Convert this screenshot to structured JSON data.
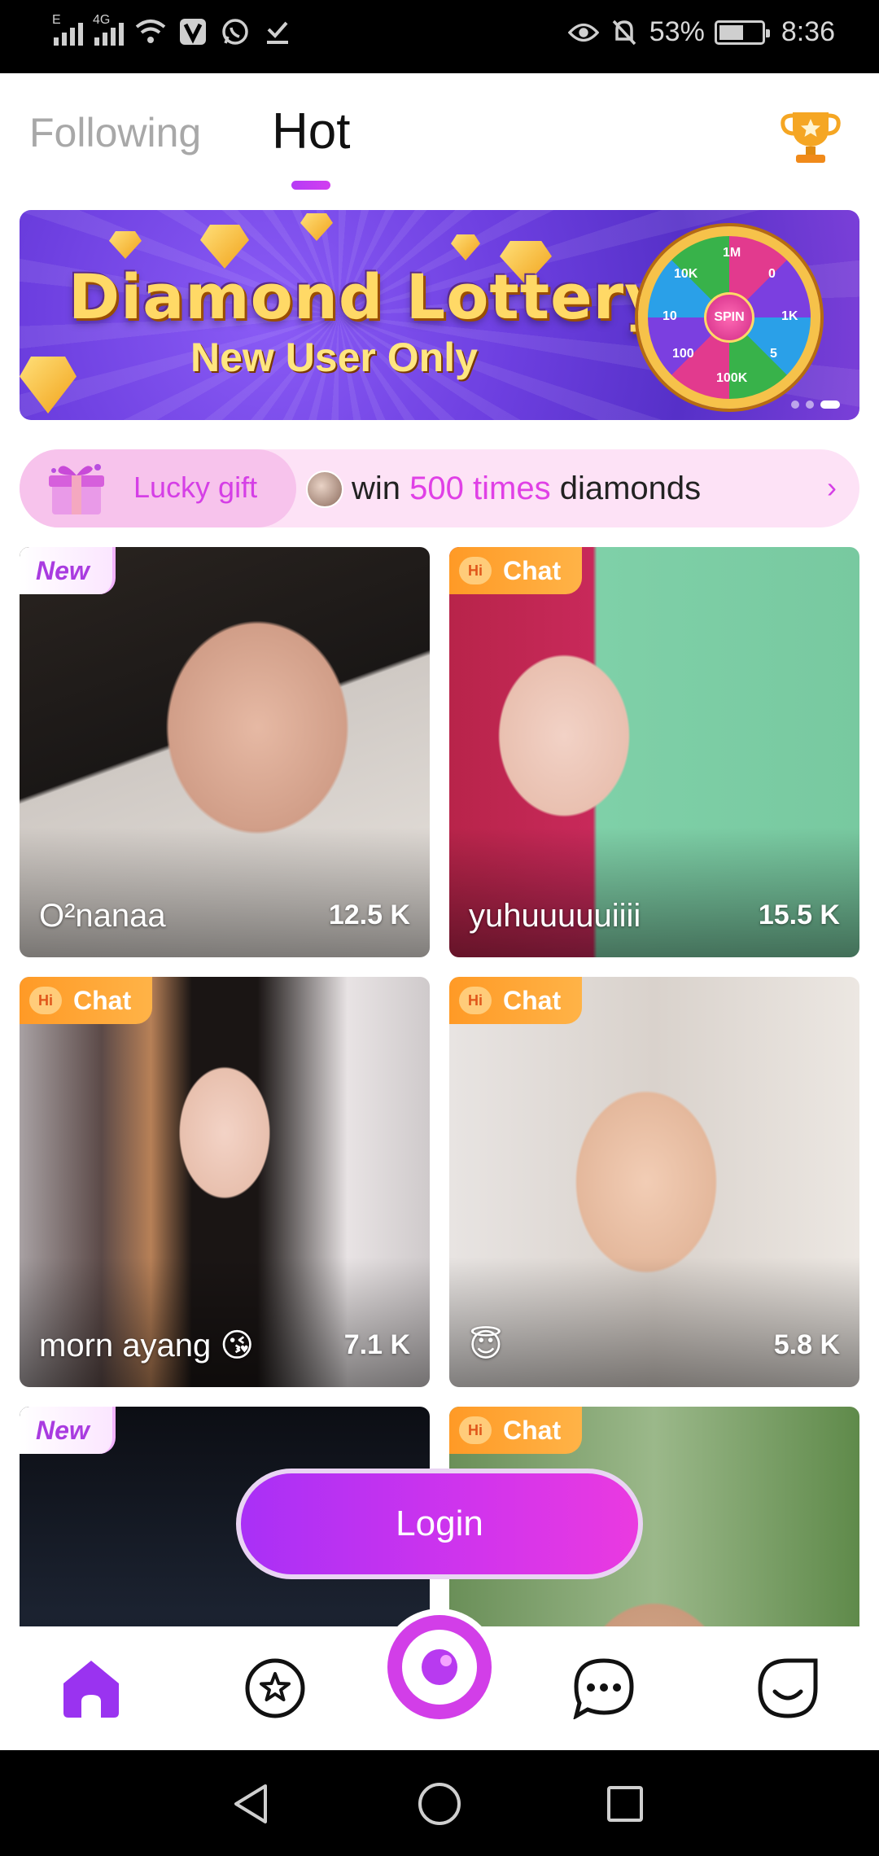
{
  "status_bar": {
    "network_label": "4G",
    "signal_label_1": "E",
    "battery": "53%",
    "time": "8:36"
  },
  "tabs": {
    "following": "Following",
    "hot": "Hot"
  },
  "banner": {
    "title": "Diamond Lottery",
    "subtitle": "New User Only",
    "wheel_center": "SPIN",
    "wheel_labels": [
      "1M",
      "0",
      "1K",
      "5",
      "100K",
      "100",
      "10",
      "10K"
    ]
  },
  "lucky_gift": {
    "label": "Lucky gift",
    "text_prefix": "win",
    "text_highlight": "500 times",
    "text_suffix": "diamonds",
    "chevron": "›"
  },
  "badges": {
    "new": "New",
    "hi": "Hi",
    "chat": "Chat"
  },
  "cards": [
    {
      "badge": "new",
      "name": "O²nanaa",
      "count": "12.5 K"
    },
    {
      "badge": "chat",
      "name": "yuhuuuuuiiii",
      "count": "15.5 K"
    },
    {
      "badge": "chat",
      "name": "morn ayang 😘",
      "count": "7.1 K"
    },
    {
      "badge": "chat",
      "name": "😇",
      "count": "5.8 K"
    },
    {
      "badge": "new",
      "name": "",
      "count": ""
    },
    {
      "badge": "chat",
      "name": "",
      "count": ""
    }
  ],
  "login_label": "Login",
  "bottom_nav": [
    "home-icon",
    "star-icon",
    "live-icon",
    "chat-icon",
    "profile-icon"
  ],
  "colors": {
    "accent": "#c83af0",
    "chat_badge": "#ff9a26",
    "lucky_bg": "#fde2f6"
  }
}
